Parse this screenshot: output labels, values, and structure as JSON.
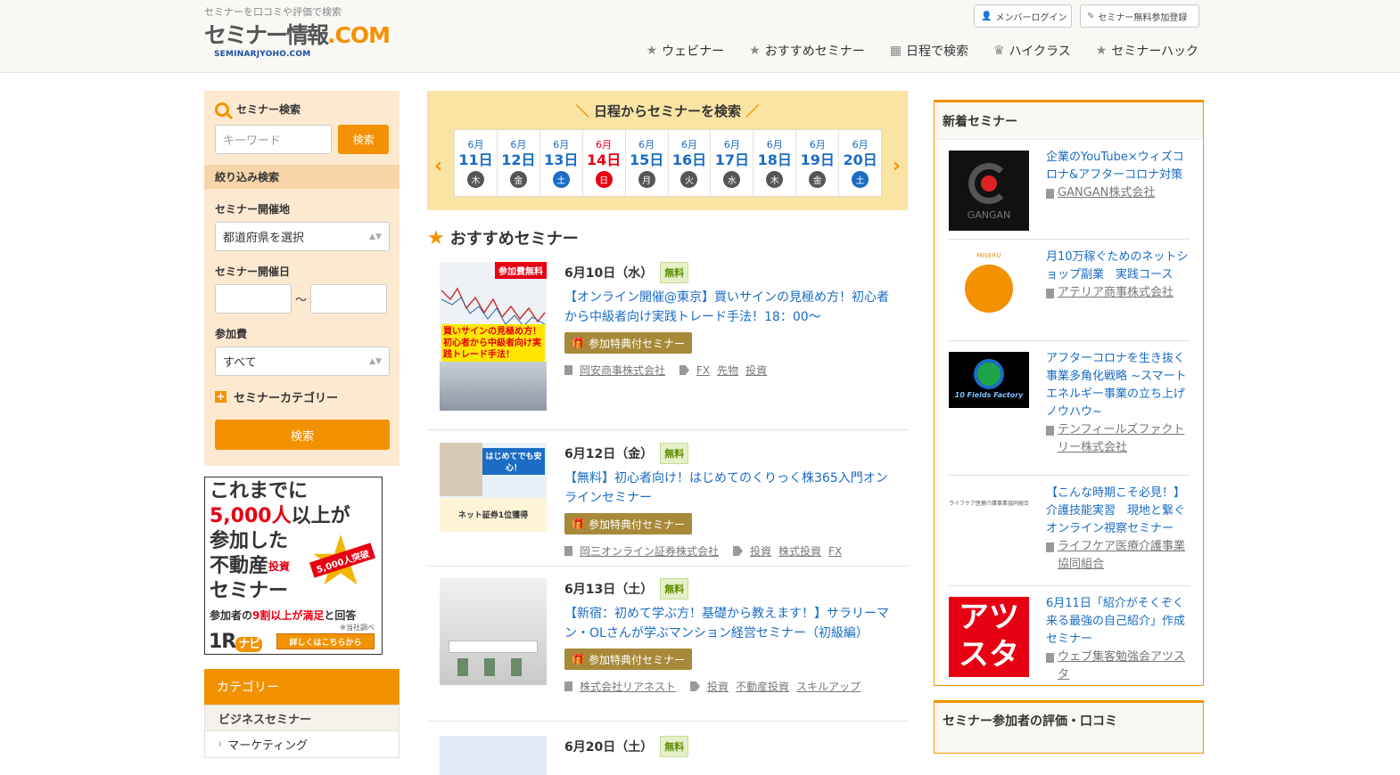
{
  "header": {
    "tagline": "セミナーを口コミや評価で検索",
    "logo_main": "セミナー情報",
    "logo_com": ".COM",
    "logo_sub": "SEMINARJYOHO.COM",
    "login_label": "メンバーログイン",
    "register_label": "セミナー無料参加登録",
    "nav": [
      {
        "label": "ウェビナー",
        "icon": "star-icon"
      },
      {
        "label": "おすすめセミナー",
        "icon": "star-icon"
      },
      {
        "label": "日程で検索",
        "icon": "calendar-icon"
      },
      {
        "label": "ハイクラス",
        "icon": "trophy-icon"
      },
      {
        "label": "セミナーハック",
        "icon": "star-icon"
      }
    ]
  },
  "sidebar": {
    "search_title": "セミナー検索",
    "keyword_placeholder": "キーワード",
    "keyword_button": "検索",
    "narrow_title": "絞り込み検索",
    "venue_label": "セミナー開催地",
    "venue_value": "都道府県を選択",
    "date_label": "セミナー開催日",
    "date_sep": "～",
    "fee_label": "参加費",
    "fee_value": "すべて",
    "category_toggle": "セミナーカテゴリー",
    "search_button": "検索",
    "ad": {
      "line1": "これまでに",
      "line2_red": "5,000人",
      "line2_rest": "以上が",
      "line3": "参加した",
      "line4": "不動産",
      "line4_small": "投資",
      "line5": "セミナー",
      "badge": "5,000人突破",
      "foot_pre": "参加者の",
      "foot_red": "9割以上が満足",
      "foot_post": "と回答",
      "note": "※当社調べ",
      "logo": "1R",
      "logo_tag": "ナビ",
      "cta": "詳しくはこちらから"
    },
    "category_head": "カテゴリー",
    "category_sub": "ビジネスセミナー",
    "category_item": "マーケティング"
  },
  "calendar": {
    "title": "日程からセミナーを検索",
    "prev": "‹",
    "next": "›",
    "days": [
      {
        "m": "6月",
        "d": "11日",
        "w": "木",
        "t": "weekday"
      },
      {
        "m": "6月",
        "d": "12日",
        "w": "金",
        "t": "weekday"
      },
      {
        "m": "6月",
        "d": "13日",
        "w": "土",
        "t": "sat"
      },
      {
        "m": "6月",
        "d": "14日",
        "w": "日",
        "t": "sun"
      },
      {
        "m": "6月",
        "d": "15日",
        "w": "月",
        "t": "weekday"
      },
      {
        "m": "6月",
        "d": "16日",
        "w": "火",
        "t": "weekday"
      },
      {
        "m": "6月",
        "d": "17日",
        "w": "水",
        "t": "weekday"
      },
      {
        "m": "6月",
        "d": "18日",
        "w": "木",
        "t": "weekday"
      },
      {
        "m": "6月",
        "d": "19日",
        "w": "金",
        "t": "weekday"
      },
      {
        "m": "6月",
        "d": "20日",
        "w": "土",
        "t": "sat"
      }
    ]
  },
  "recommend": {
    "title": "おすすめセミナー",
    "items": [
      {
        "date": "6月10日（水）",
        "free": "無料",
        "title": "【オンライン開催@東京】買いサインの見極め方！初心者から中級者向け実践トレード手法！18：00～",
        "perk": "参加特典付セミナー",
        "company": "岡安商事株式会社",
        "tags": [
          "FX",
          "先物",
          "投資"
        ],
        "thumb_badge": "参加費無料",
        "thumb_text": "買いサインの見極め方！初心者から中級者向け実践トレード手法！"
      },
      {
        "date": "6月12日（金）",
        "free": "無料",
        "title": "【無料】初心者向け！はじめてのくりっく株365入門オンラインセミナー",
        "perk": "参加特典付セミナー",
        "company": "岡三オンライン証券株式会社",
        "tags": [
          "投資",
          "株式投資",
          "FX"
        ],
        "thumb_badge": "はじめてでも安心！",
        "thumb_text": "ネット証券1位獲得"
      },
      {
        "date": "6月13日（土）",
        "free": "無料",
        "title": "【新宿：初めて学ぶ方！基礎から教えます！】サラリーマン・OLさんが学ぶマンション経営セミナー（初級編）",
        "perk": "参加特典付セミナー",
        "company": "株式会社リアネスト",
        "tags": [
          "投資",
          "不動産投資",
          "スキルアップ"
        ]
      },
      {
        "date": "6月20日（土）",
        "free": "無料"
      }
    ]
  },
  "new_seminars": {
    "title": "新着セミナー",
    "items": [
      {
        "title": "企業のYouTube×ウィズコロナ&アフターコロナ対策",
        "company": "GANGAN株式会社",
        "logo": "GANGAN"
      },
      {
        "title": "月10万稼ぐためのネットショップ副業　実践コース",
        "company": "アテリア商事株式会社",
        "logo": "MISERU"
      },
      {
        "title": "アフターコロナを生き抜く事業多角化戦略 ~スマートエネルギー事業の立ち上げノウハウ~",
        "company": "テンフィールズファクトリー株式会社",
        "logo": "10 Fields Factory"
      },
      {
        "title": "【こんな時期こそ必見！】介護技能実習　現地と繋ぐオンライン視察セミナー",
        "company": "ライフケア医療介護事業協同組合",
        "logo": "ライフケア医療介護事業協同組合"
      },
      {
        "title": "6月11日「紹介がそくぞく来る最強の自己紹介」作成セミナー",
        "company": "ウェブ集客勉強会アツスタ",
        "logo": "アツスタ"
      }
    ]
  },
  "eval_title": "セミナー参加者の評価・口コミ",
  "colors": {
    "accent": "#f39200",
    "link": "#1a6cc4",
    "sunday": "#e60012",
    "saturday": "#1a6cc4"
  }
}
